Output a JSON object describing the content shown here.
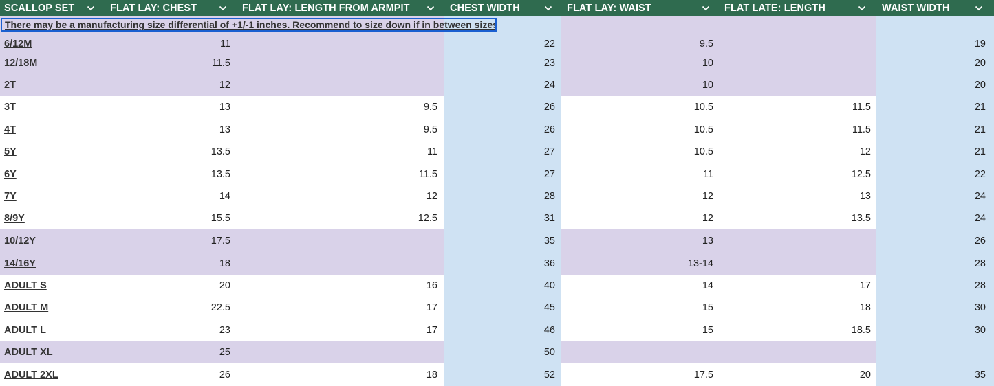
{
  "colors": {
    "header_bg": "#2f6b4f",
    "header_text": "#ffffff",
    "blue_column": "#cfe2f3",
    "purple_band": "#d9d2e9",
    "selection_border": "#1a5fd0"
  },
  "header": {
    "columns": [
      {
        "label": "SCALLOP SET",
        "icon": "chevron-down-icon"
      },
      {
        "label": "FLAT LAY: CHEST",
        "icon": "chevron-down-icon"
      },
      {
        "label": "FLAT LAY: LENGTH FROM ARMPIT",
        "icon": "chevron-down-icon"
      },
      {
        "label": "CHEST WIDTH",
        "icon": "chevron-down-icon"
      },
      {
        "label": "FLAT LAY: WAIST",
        "icon": "chevron-down-icon"
      },
      {
        "label": "FLAT LATE: LENGTH",
        "icon": "chevron-down-icon"
      },
      {
        "label": "WAIST WIDTH",
        "icon": "chevron-down-icon"
      }
    ]
  },
  "note": "There may be a manufacturing size differential of +1/-1 inches. Recommend to size down if in between sizes.",
  "rows": [
    {
      "size": "6/12M",
      "chest": "11",
      "length": "",
      "chest_width": "22",
      "waist": "9.5",
      "pant_length": "",
      "waist_width": "19",
      "band": "purple"
    },
    {
      "size": "12/18M",
      "chest": "11.5",
      "length": "",
      "chest_width": "23",
      "waist": "10",
      "pant_length": "",
      "waist_width": "20",
      "band": "purple"
    },
    {
      "size": "2T",
      "chest": "12",
      "length": "",
      "chest_width": "24",
      "waist": "10",
      "pant_length": "",
      "waist_width": "20",
      "band": "purple"
    },
    {
      "size": "3T",
      "chest": "13",
      "length": "9.5",
      "chest_width": "26",
      "waist": "10.5",
      "pant_length": "11.5",
      "waist_width": "21",
      "band": "white"
    },
    {
      "size": "4T",
      "chest": "13",
      "length": "9.5",
      "chest_width": "26",
      "waist": "10.5",
      "pant_length": "11.5",
      "waist_width": "21",
      "band": "white"
    },
    {
      "size": "5Y",
      "chest": "13.5",
      "length": "11",
      "chest_width": "27",
      "waist": "10.5",
      "pant_length": "12",
      "waist_width": "21",
      "band": "white"
    },
    {
      "size": "6Y",
      "chest": "13.5",
      "length": "11.5",
      "chest_width": "27",
      "waist": "11",
      "pant_length": "12.5",
      "waist_width": "22",
      "band": "white"
    },
    {
      "size": "7Y",
      "chest": "14",
      "length": "12",
      "chest_width": "28",
      "waist": "12",
      "pant_length": "13",
      "waist_width": "24",
      "band": "white"
    },
    {
      "size": "8/9Y",
      "chest": "15.5",
      "length": "12.5",
      "chest_width": "31",
      "waist": "12",
      "pant_length": "13.5",
      "waist_width": "24",
      "band": "white"
    },
    {
      "size": "10/12Y",
      "chest": "17.5",
      "length": "",
      "chest_width": "35",
      "waist": "13",
      "pant_length": "",
      "waist_width": "26",
      "band": "purple"
    },
    {
      "size": "14/16Y",
      "chest": "18",
      "length": "",
      "chest_width": "36",
      "waist": "13-14",
      "pant_length": "",
      "waist_width": "28",
      "band": "purple"
    },
    {
      "size": "ADULT S",
      "chest": "20",
      "length": "16",
      "chest_width": "40",
      "waist": "14",
      "pant_length": "17",
      "waist_width": "28",
      "band": "white"
    },
    {
      "size": "ADULT M",
      "chest": "22.5",
      "length": "17",
      "chest_width": "45",
      "waist": "15",
      "pant_length": "18",
      "waist_width": "30",
      "band": "white"
    },
    {
      "size": "ADULT L",
      "chest": "23",
      "length": "17",
      "chest_width": "46",
      "waist": "15",
      "pant_length": "18.5",
      "waist_width": "30",
      "band": "white"
    },
    {
      "size": "ADULT XL",
      "chest": "25",
      "length": "",
      "chest_width": "50",
      "waist": "",
      "pant_length": "",
      "waist_width": "",
      "band": "purple"
    },
    {
      "size": "ADULT 2XL",
      "chest": "26",
      "length": "18",
      "chest_width": "52",
      "waist": "17.5",
      "pant_length": "20",
      "waist_width": "35",
      "band": "white"
    }
  ]
}
